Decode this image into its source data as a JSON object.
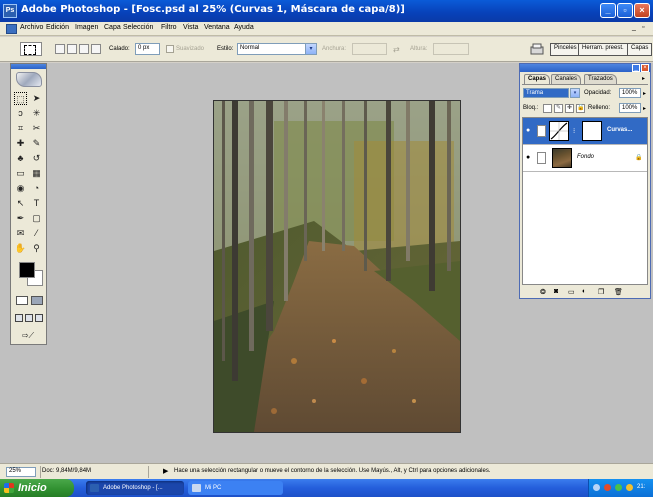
{
  "window": {
    "title": "Adobe Photoshop - [Fosc.psd al 25% (Curvas 1, Máscara de capa/8)]",
    "app_icon_text": "Ps",
    "controls": {
      "minimize": "_",
      "restore": "▫",
      "close": "×"
    }
  },
  "menubar": {
    "items": [
      "Archivo",
      "Edición",
      "Imagen",
      "Capa",
      "Selección",
      "Filtro",
      "Vista",
      "Ventana",
      "Ayuda"
    ],
    "doc_controls": {
      "minimize": "_",
      "restore": "▫"
    }
  },
  "options_bar": {
    "feather_label": "Calado:",
    "feather_value": "0 px",
    "antialias_label": "Suavizado",
    "style_label": "Estilo:",
    "style_value": "Normal",
    "width_label": "Anchura:",
    "height_label": "Altura:",
    "swap_glyph": "⇄",
    "palette_buttons": [
      "Pinceles",
      "Herram. preest.",
      "Capas"
    ]
  },
  "toolbox": {
    "tools": [
      "marquee-icon",
      "move-icon",
      "lasso-icon",
      "magic-wand-icon",
      "crop-icon",
      "slice-icon",
      "healing-icon",
      "brush-icon",
      "stamp-icon",
      "history-brush-icon",
      "eraser-icon",
      "gradient-icon",
      "blur-icon",
      "dodge-icon",
      "path-select-icon",
      "type-icon",
      "pen-icon",
      "shape-icon",
      "notes-icon",
      "eyedropper-icon",
      "hand-icon",
      "zoom-icon"
    ],
    "glyphs": [
      "⬚",
      "➤",
      "ↄ",
      "✳",
      "⌗",
      "✂",
      "✚",
      "✎",
      "♣",
      "↺",
      "▭",
      "▦",
      "◉",
      "◔",
      "↖",
      "T",
      "✒",
      "▢",
      "✉",
      "⁄",
      "✋",
      "⚲"
    ],
    "foreground_color": "#000000",
    "background_color": "#ffffff"
  },
  "layers_palette": {
    "tabs": [
      "Capas",
      "Canales",
      "Trazados"
    ],
    "blend_mode": "Trama",
    "opacity_label": "Opacidad:",
    "opacity_value": "100%",
    "lock_label": "Bloq.:",
    "fill_label": "Relleno:",
    "fill_value": "100%",
    "layers": [
      {
        "name": "Curvas...",
        "active": true
      },
      {
        "name": "Fondo",
        "active": false
      }
    ]
  },
  "statusbar": {
    "zoom": "25%",
    "doc_info": "Doc: 9,84M/9,84M",
    "hint": "Hace una selección rectangular o mueve el contorno de la selección. Use Mayús., Alt, y Ctrl para opciones adicionales."
  },
  "taskbar": {
    "start_label": "Inicio",
    "tasks": [
      {
        "label": "Adobe Photoshop - [...",
        "active": true
      },
      {
        "label": "Mi PC",
        "active": false
      }
    ],
    "clock": "21:"
  }
}
